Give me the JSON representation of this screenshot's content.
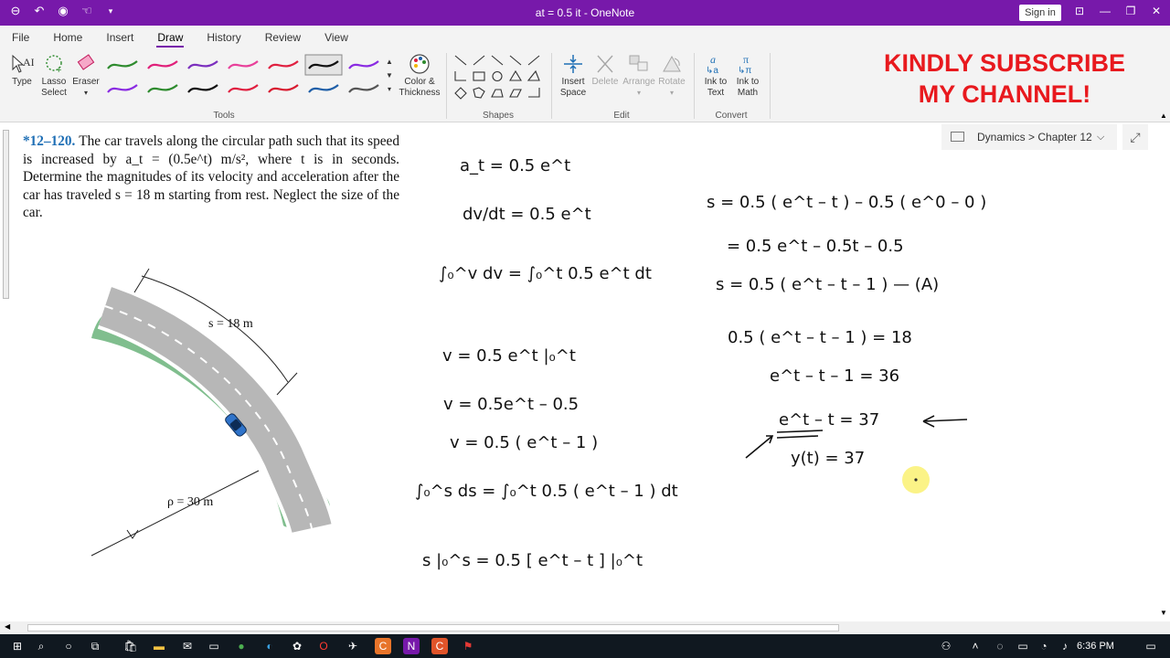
{
  "window": {
    "title": "at = 0.5 it  -  OneNote",
    "signin": "Sign in",
    "qat_icons": [
      "back-icon",
      "undo-icon",
      "circle-icon",
      "touch-mode-icon",
      "dropdown-icon"
    ]
  },
  "tabs": [
    {
      "label": "File"
    },
    {
      "label": "Home"
    },
    {
      "label": "Insert"
    },
    {
      "label": "Draw",
      "active": true
    },
    {
      "label": "History"
    },
    {
      "label": "Review"
    },
    {
      "label": "View"
    }
  ],
  "ribbon": {
    "type_label": "Type",
    "lasso_label": "Lasso Select",
    "eraser_label": "Eraser",
    "color_label": "Color & Thickness",
    "tools_group": "Tools",
    "shapes_group": "Shapes",
    "insert_space_label": "Insert Space",
    "delete_label": "Delete",
    "arrange_label": "Arrange",
    "rotate_label": "Rotate",
    "edit_group": "Edit",
    "ink_to_text_label": "Ink to Text",
    "ink_to_math_label": "Ink to Math",
    "convert_group": "Convert",
    "pens_row1": [
      "#2e8b2e",
      "#e0207a",
      "#7b2fbe",
      "#e8409a",
      "#e02040",
      "#111111",
      "#8a2be2"
    ],
    "pens_row2": [
      "#8a2be2",
      "#2e8b2e",
      "#111111",
      "#e02040",
      "#d81b30",
      "#1f5fa8",
      "#555555"
    ]
  },
  "overlay": {
    "line1": "KINDLY SUBSCRIBE",
    "line2": "MY CHANNEL!"
  },
  "breadcrumb": {
    "text": "Dynamics > Chapter 12"
  },
  "problem": {
    "number": "*12–120.",
    "text": "The car travels along the circular path such that its speed is increased by a_t = (0.5e^t) m/s², where t is in seconds. Determine the magnitudes of its velocity and acceleration after the car has traveled s = 18 m starting from rest. Neglect the size of the car."
  },
  "figure": {
    "s_label": "s = 18 m",
    "rho_label": "ρ = 30 m"
  },
  "ink": {
    "left_column": [
      "a_t = 0.5 e^t",
      "dv/dt = 0.5 e^t",
      "∫₀^v dv = ∫₀^t 0.5 e^t dt",
      "v = 0.5 e^t |₀^t",
      "v = 0.5e^t – 0.5",
      "v = 0.5 ( e^t – 1 )",
      "∫₀^s ds = ∫₀^t 0.5 ( e^t – 1 ) dt",
      "s |₀^s = 0.5 [ e^t – t ] |₀^t"
    ],
    "right_column": [
      "s = 0.5 ( e^t – t ) – 0.5 ( e^0 – 0 )",
      "= 0.5 e^t – 0.5t – 0.5",
      "s = 0.5 ( e^t – t – 1 ) — (A)",
      "0.5 ( e^t – t – 1 ) = 18",
      "e^t – t – 1 = 36",
      "e^t – t = 37",
      "y(t) = 37"
    ]
  },
  "taskbar": {
    "time": "6:36 PM"
  }
}
